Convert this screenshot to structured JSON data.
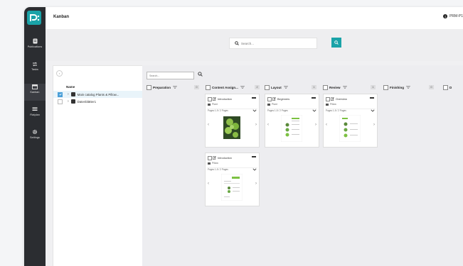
{
  "app": {
    "title": "Kanban",
    "user": "PRM-P1"
  },
  "sidebar": {
    "items": [
      {
        "label": "Publications",
        "icon": "publications-icon"
      },
      {
        "label": "Tasks",
        "icon": "tasks-icon"
      },
      {
        "label": "Kanban",
        "icon": "kanban-icon"
      },
      {
        "label": "Flatplan",
        "icon": "flatplan-icon"
      },
      {
        "label": "Settings",
        "icon": "gear-icon"
      }
    ]
  },
  "search": {
    "placeholder": "Search..."
  },
  "tree": {
    "column_header": "Name",
    "items": [
      {
        "label": "Main catalog Plants & Pillow...",
        "checked": true
      },
      {
        "label": "Datenblätter1",
        "checked": false
      }
    ]
  },
  "board": {
    "search_placeholder": "Search...",
    "columns": [
      {
        "title": "Preparation",
        "count": "0"
      },
      {
        "title": "Content Assign...",
        "count": "2"
      },
      {
        "title": "Layout",
        "count": "1"
      },
      {
        "title": "Review",
        "count": "1"
      },
      {
        "title": "Finishing",
        "count": "0"
      },
      {
        "title": "D",
        "count": ""
      }
    ],
    "cards": [
      {
        "title": "Introduction",
        "folder": "Plant",
        "pages": "Pages 1-9 / 2 Pages"
      },
      {
        "title": "Introduction",
        "folder": "Pillow",
        "pages": "Pages 1-5 / 2 Pages"
      },
      {
        "title": "Beginners",
        "folder": "Plant",
        "pages": "Pages 1-5 / 2 Pages"
      },
      {
        "title": "Overview",
        "folder": "Pillow",
        "pages": "Pages 1-5 / 2 Pages"
      }
    ]
  },
  "colors": {
    "accent": "#1aa3a8",
    "sidebar": "#2b2d31",
    "check": "#4a9fd8"
  }
}
